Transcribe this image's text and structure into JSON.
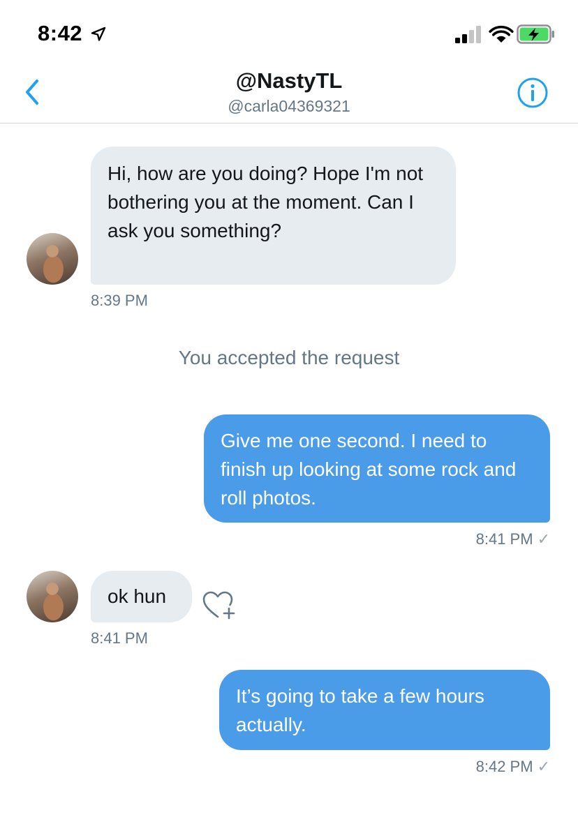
{
  "status_bar": {
    "time": "8:42"
  },
  "header": {
    "title": "@NastyTL",
    "subtitle": "@carla04369321"
  },
  "messages": [
    {
      "direction": "incoming",
      "text": "Hi, how are you doing? Hope I'm not bothering you at the moment. Can I ask you something?",
      "time": "8:39 PM"
    },
    {
      "direction": "system",
      "text": "You accepted the request"
    },
    {
      "direction": "outgoing",
      "text": "Give me one second. I need to finish up looking at some rock and roll photos.",
      "time": "8:41 PM",
      "status": "✓"
    },
    {
      "direction": "incoming",
      "text": "ok hun",
      "time": "8:41 PM"
    },
    {
      "direction": "outgoing",
      "text": "It’s going to take a few hours actually.",
      "time": "8:42 PM",
      "status": "✓"
    }
  ],
  "icons": [
    "location-arrow-icon",
    "signal-icon",
    "wifi-icon",
    "battery-charging-icon",
    "back-chevron-icon",
    "info-icon",
    "avatar",
    "heart-plus-icon",
    "read-checkmark-icon"
  ],
  "colors": {
    "accent": "#1da1f2",
    "outgoing_bubble": "#4a9be8",
    "incoming_bubble": "#e6ecf0",
    "secondary_text": "#657786",
    "battery": "#4cd964"
  }
}
